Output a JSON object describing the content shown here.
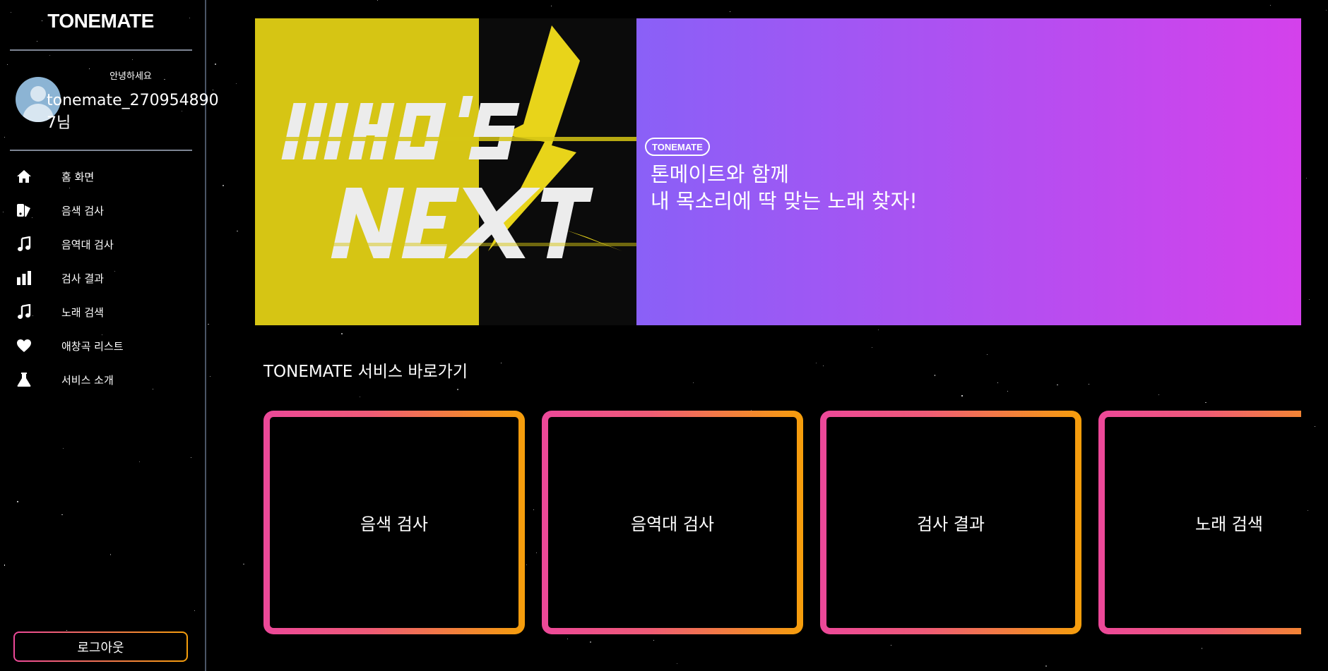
{
  "app": {
    "logo": "TONEMATE"
  },
  "user": {
    "greeting": "안녕하세요",
    "name": "tonemate_2709548907님"
  },
  "nav": [
    {
      "label": "홈 화면",
      "icon": "home-icon"
    },
    {
      "label": "음색 검사",
      "icon": "palette-icon"
    },
    {
      "label": "음역대 검사",
      "icon": "music-note-icon"
    },
    {
      "label": "검사 결과",
      "icon": "bar-chart-icon"
    },
    {
      "label": "노래 검색",
      "icon": "music-note-icon"
    },
    {
      "label": "애창곡 리스트",
      "icon": "heart-icon"
    },
    {
      "label": "서비스 소개",
      "icon": "flask-icon"
    }
  ],
  "logout_label": "로그아웃",
  "banner": {
    "poster_icon": "whos-next-poster-image",
    "badge": "TONEMATE",
    "line1": "톤메이트와 함께",
    "line2": "내 목소리에 딱 맞는 노래 찾자!"
  },
  "services": {
    "title": "TONEMATE 서비스 바로가기",
    "cards": [
      {
        "label": "음색 검사"
      },
      {
        "label": "음역대 검사"
      },
      {
        "label": "검사 결과"
      },
      {
        "label": "노래 검색"
      }
    ]
  },
  "colors": {
    "accent_pink": "#ec4899",
    "accent_orange": "#f59e0b",
    "banner_start": "#8a60f7",
    "banner_end": "#d441eb",
    "poster_yellow": "#d6c514"
  }
}
